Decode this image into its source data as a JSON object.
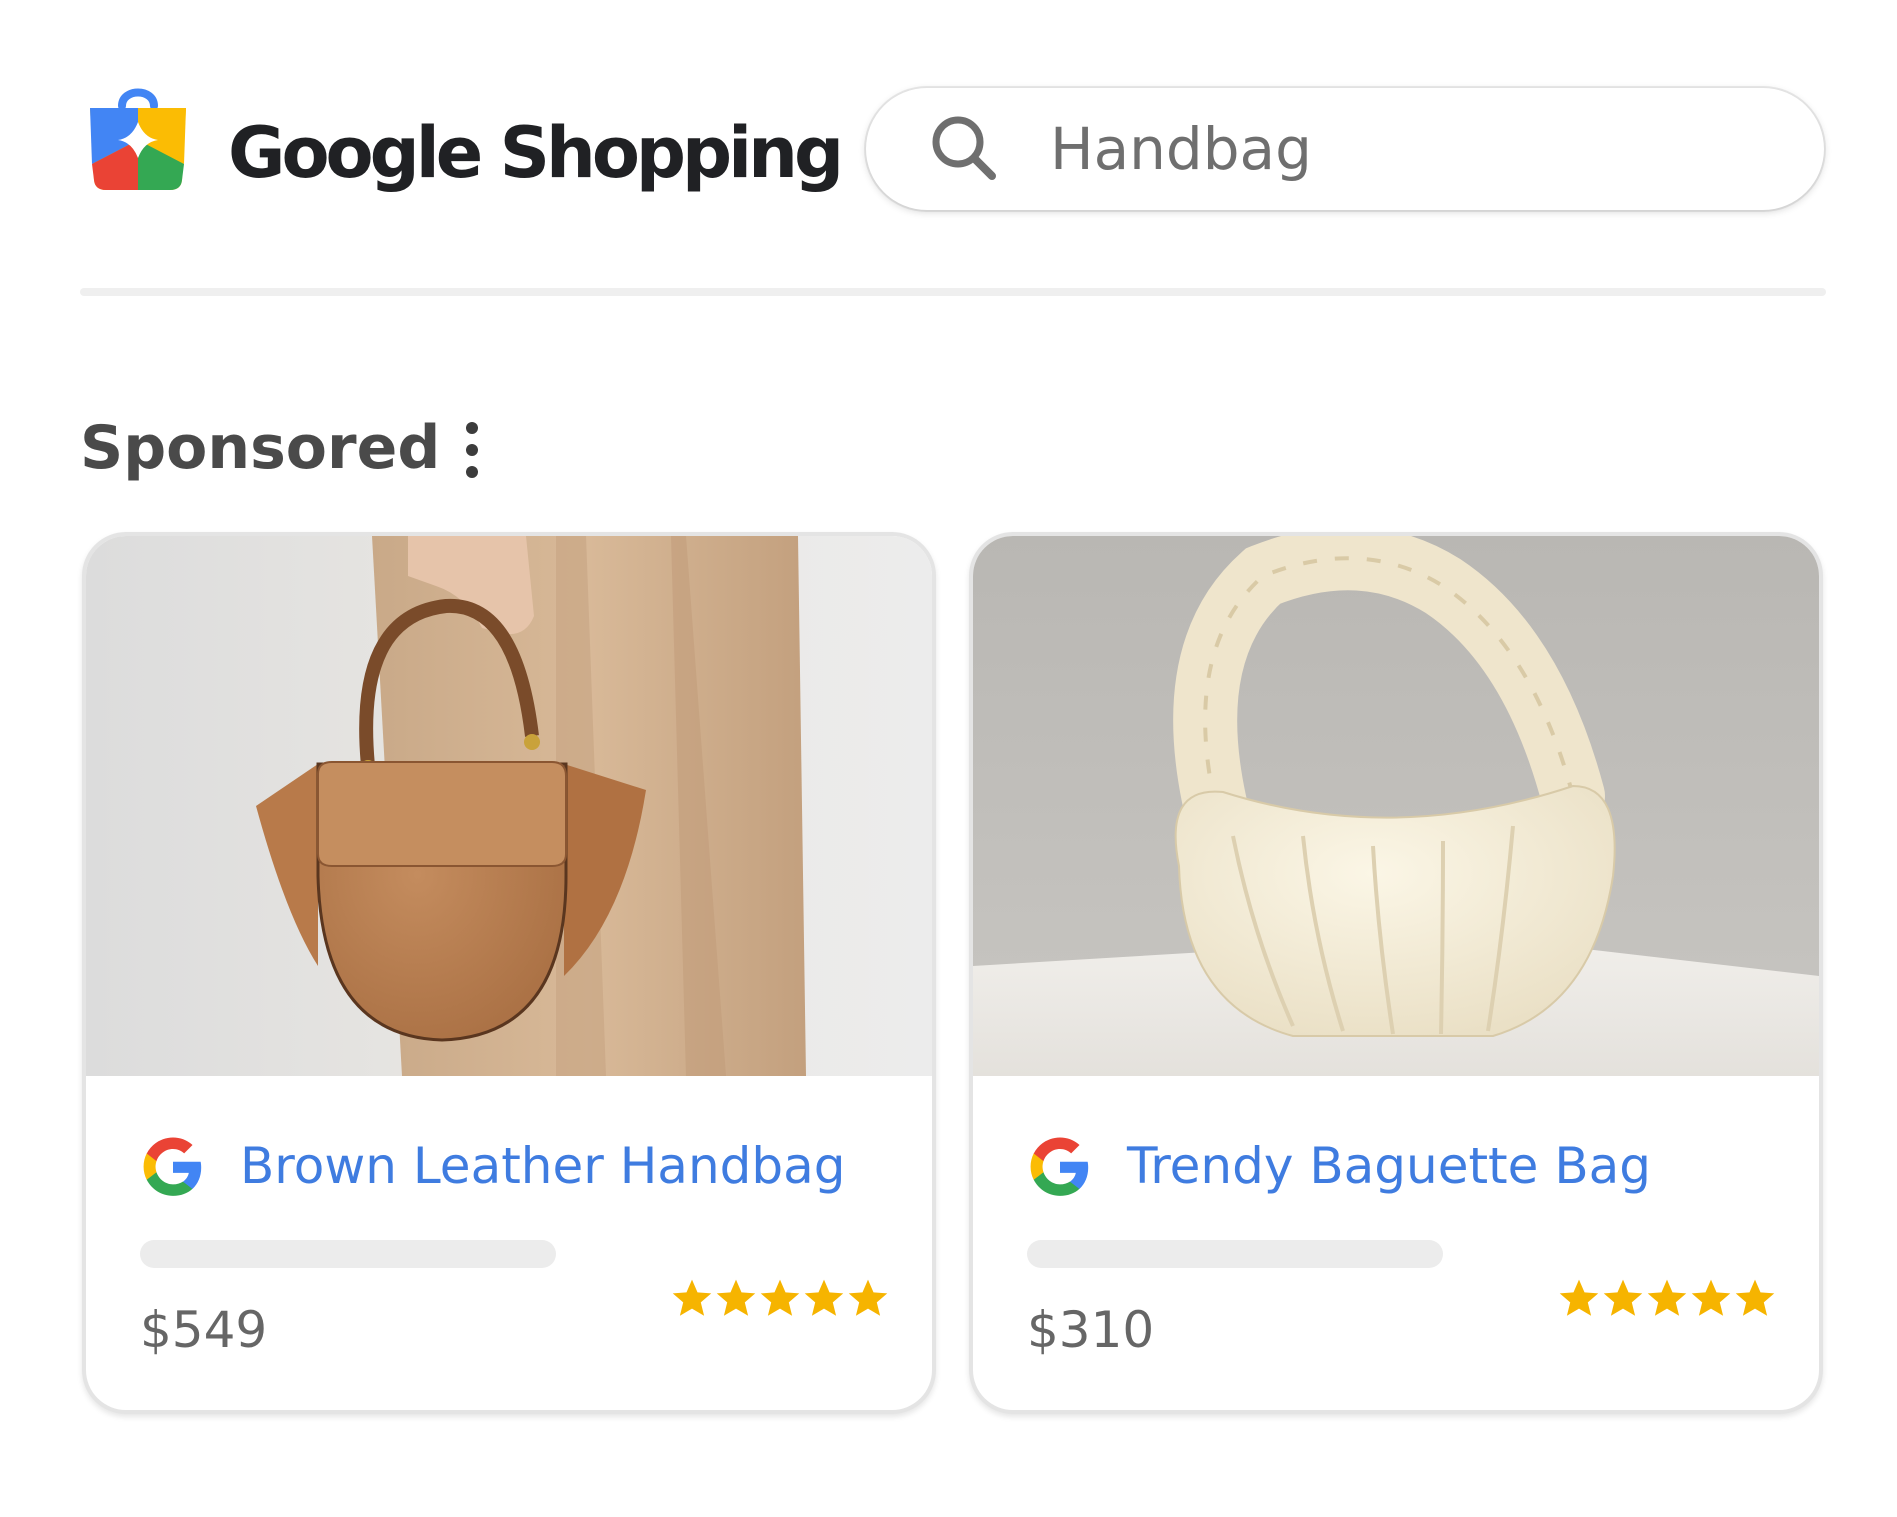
{
  "header": {
    "brand_title": "Google Shopping",
    "search": {
      "value": "Handbag",
      "placeholder": "Handbag"
    }
  },
  "section": {
    "label": "Sponsored",
    "menu_icon": "more-vert-icon"
  },
  "products": [
    {
      "title": "Brown Leather Handbag",
      "price": "$549",
      "rating": 5,
      "rating_max": 5,
      "merchant_icon": "google-g-icon",
      "image_description_icon": "brown-leather-handbag-photo"
    },
    {
      "title": "Trendy Baguette Bag",
      "price": "$310",
      "rating": 5,
      "rating_max": 5,
      "merchant_icon": "google-g-icon",
      "image_description_icon": "cream-baguette-bag-photo"
    }
  ],
  "colors": {
    "title_link": "#3f7ce0",
    "star": "#f6b400",
    "price": "#666666",
    "brand_text": "#202124"
  }
}
